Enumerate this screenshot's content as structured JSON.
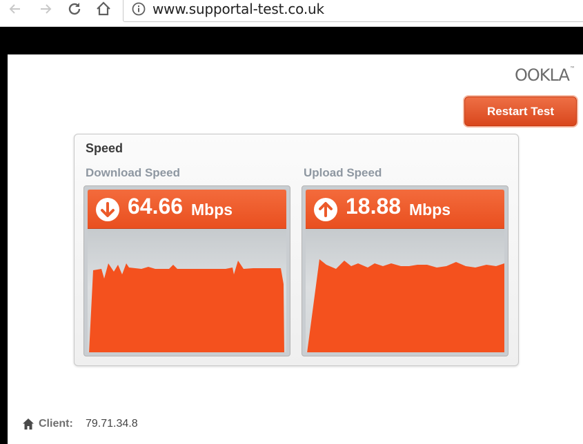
{
  "browser": {
    "url": "www.supportal-test.co.uk",
    "icons": {
      "back": "arrow-left-icon",
      "forward": "arrow-right-icon",
      "reload": "reload-icon",
      "home": "home-icon",
      "info": "info-icon"
    }
  },
  "logo": {
    "text": "OOKLA"
  },
  "restart_button": {
    "label": "Restart Test"
  },
  "panel": {
    "title": "Speed",
    "download": {
      "label": "Download Speed",
      "value": "64.66",
      "unit": "Mbps",
      "icon": "arrow-down-circle-icon"
    },
    "upload": {
      "label": "Upload Speed",
      "value": "18.88",
      "unit": "Mbps",
      "icon": "arrow-up-circle-icon"
    }
  },
  "client": {
    "label": "Client:",
    "ip": "79.71.34.8",
    "icon": "home-icon"
  },
  "colors": {
    "accent": "#f4511e",
    "header": "#ec5a2a",
    "label_gray": "#8e97a1"
  }
}
